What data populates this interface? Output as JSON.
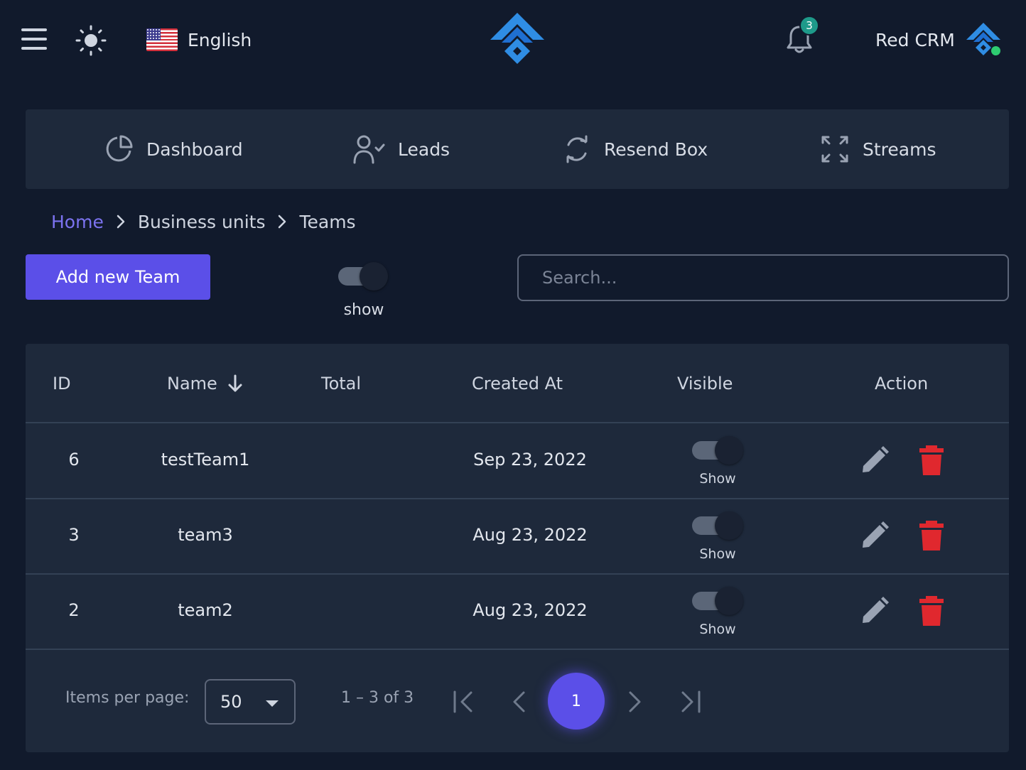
{
  "header": {
    "language": "English",
    "notification_count": "3",
    "user_name": "Red CRM"
  },
  "nav": {
    "items": [
      {
        "label": "Dashboard",
        "icon": "pie-chart-icon"
      },
      {
        "label": "Leads",
        "icon": "user-check-icon"
      },
      {
        "label": "Resend Box",
        "icon": "refresh-icon"
      },
      {
        "label": "Streams",
        "icon": "expand-icon"
      }
    ]
  },
  "breadcrumb": {
    "home": "Home",
    "level1": "Business units",
    "level2": "Teams"
  },
  "toolbar": {
    "add_label": "Add new Team",
    "toggle_label": "show",
    "search_placeholder": "Search..."
  },
  "table": {
    "columns": [
      "ID",
      "Name",
      "Total",
      "Created At",
      "Visible",
      "Action"
    ],
    "sort": {
      "column": "Name",
      "direction": "desc"
    },
    "rows": [
      {
        "id": "6",
        "name": "testTeam1",
        "total": "",
        "created_at": "Sep 23, 2022",
        "visible_label": "Show"
      },
      {
        "id": "3",
        "name": "team3",
        "total": "",
        "created_at": "Aug 23, 2022",
        "visible_label": "Show"
      },
      {
        "id": "2",
        "name": "team2",
        "total": "",
        "created_at": "Aug 23, 2022",
        "visible_label": "Show"
      }
    ]
  },
  "paginator": {
    "items_per_page_label": "Items per page:",
    "items_per_page": "50",
    "range": "1 – 3 of 3",
    "current_page": "1"
  },
  "colors": {
    "background": "#111a2c",
    "card": "#1e293b",
    "accent": "#5b4fe8",
    "link": "#7c73f0",
    "delete": "#e0282e",
    "badge": "#1e9a8a",
    "online": "#2ecc71"
  }
}
